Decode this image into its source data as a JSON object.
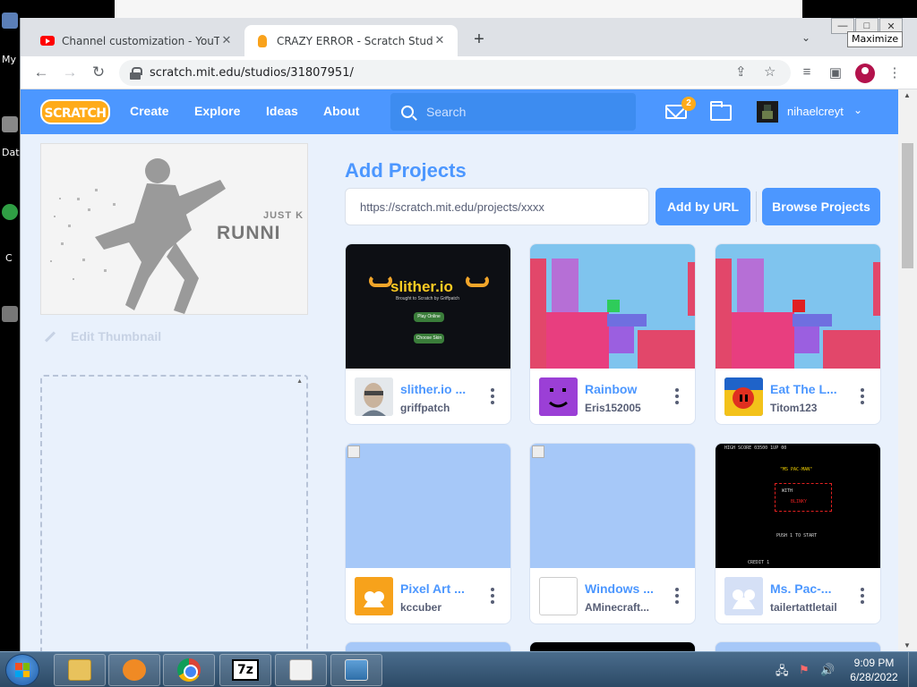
{
  "desktop": {
    "labels": [
      "My",
      "Dat",
      "C"
    ]
  },
  "browser": {
    "tabs": [
      {
        "title": "Channel customization - YouTube",
        "favicon": "youtube-icon",
        "active": false
      },
      {
        "title": "CRAZY ERROR - Scratch Studio",
        "favicon": "scratch-icon",
        "active": true
      }
    ],
    "new_tab_label": "+",
    "url": "scratch.mit.edu/studios/31807951/",
    "tooltip": "Maximize",
    "window_buttons": {
      "minimize": "—",
      "maximize": "□",
      "close": "✕"
    }
  },
  "scratch_nav": {
    "logo": "SCRATCH",
    "links": [
      "Create",
      "Explore",
      "Ideas",
      "About"
    ],
    "search_placeholder": "Search",
    "message_count": "2",
    "username": "nihaelcreyt"
  },
  "sidebar": {
    "thumbnail_text": "JUST K",
    "thumbnail_title": "RUNNI",
    "edit_thumbnail": "Edit Thumbnail"
  },
  "add_projects": {
    "title": "Add Projects",
    "url_placeholder": "https://scratch.mit.edu/projects/xxxx",
    "add_by_url": "Add by URL",
    "browse_projects": "Browse Projects"
  },
  "projects": [
    {
      "title": "slither.io ...",
      "author": "griffpatch",
      "thumb": "slither"
    },
    {
      "title": "Rainbow",
      "author": "Eris152005",
      "thumb": "rainbow"
    },
    {
      "title": "Eat The L...",
      "author": "Titom123",
      "thumb": "rainbow-red"
    },
    {
      "title": "Pixel Art ...",
      "author": "kccuber",
      "thumb": "blank"
    },
    {
      "title": "Windows ...",
      "author": "AMinecraft...",
      "thumb": "blank"
    },
    {
      "title": "Ms. Pac-...",
      "author": "tailertattletail",
      "thumb": "pacman"
    }
  ],
  "slither_thumb": {
    "title": "slither.io",
    "subtitle": "Brought to Scratch by Griffpatch",
    "play": "Play Online",
    "skin": "Choose Skin"
  },
  "pacman_thumb": {
    "header": "HIGH SCORE 03500 1UP 00",
    "title": "\"MS PAC-MAN\"",
    "with": "WITH",
    "name": "BLINKY",
    "push": "PUSH 1 TO START",
    "credit": "CREDIT 1"
  },
  "taskbar": {
    "time": "9:09 PM",
    "date": "6/28/2022",
    "apps": [
      "explorer",
      "media-player",
      "chrome",
      "7zip",
      "notepad",
      "photo-viewer"
    ]
  }
}
